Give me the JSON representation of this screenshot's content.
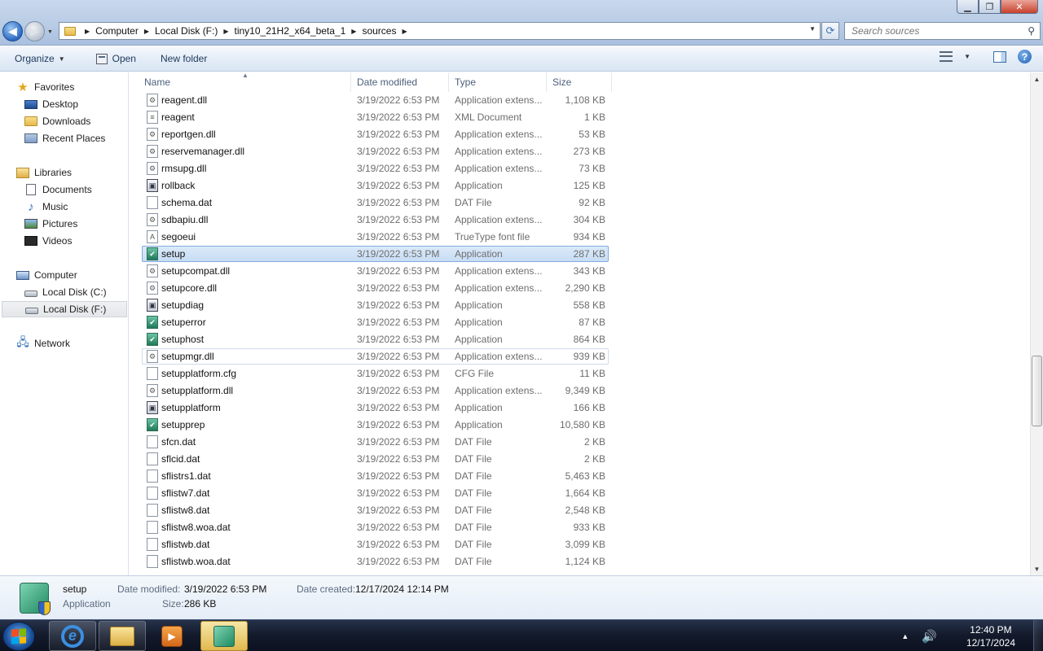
{
  "address": {
    "crumbs": [
      "Computer",
      "Local Disk (F:)",
      "tiny10_21H2_x64_beta_1",
      "sources"
    ]
  },
  "search": {
    "placeholder": "Search sources"
  },
  "toolbar": {
    "organize": "Organize",
    "open": "Open",
    "new_folder": "New folder"
  },
  "nav": {
    "favorites": "Favorites",
    "desktop": "Desktop",
    "downloads": "Downloads",
    "recent_places": "Recent Places",
    "libraries": "Libraries",
    "documents": "Documents",
    "music": "Music",
    "pictures": "Pictures",
    "videos": "Videos",
    "computer": "Computer",
    "local_disk_c": "Local Disk (C:)",
    "local_disk_f": "Local Disk (F:)",
    "network": "Network"
  },
  "columns": {
    "name": "Name",
    "date_modified": "Date modified",
    "type": "Type",
    "size": "Size"
  },
  "files": [
    {
      "name": "reagent.dll",
      "date": "3/19/2022 6:53 PM",
      "type": "Application extens...",
      "size": "1,108 KB",
      "icon": "dll-icon"
    },
    {
      "name": "reagent",
      "date": "3/19/2022 6:53 PM",
      "type": "XML Document",
      "size": "1 KB",
      "icon": "xml-icon"
    },
    {
      "name": "reportgen.dll",
      "date": "3/19/2022 6:53 PM",
      "type": "Application extens...",
      "size": "53 KB",
      "icon": "dll-icon"
    },
    {
      "name": "reservemanager.dll",
      "date": "3/19/2022 6:53 PM",
      "type": "Application extens...",
      "size": "273 KB",
      "icon": "dll-icon"
    },
    {
      "name": "rmsupg.dll",
      "date": "3/19/2022 6:53 PM",
      "type": "Application extens...",
      "size": "73 KB",
      "icon": "dll-icon"
    },
    {
      "name": "rollback",
      "date": "3/19/2022 6:53 PM",
      "type": "Application",
      "size": "125 KB",
      "icon": "app-icon"
    },
    {
      "name": "schema.dat",
      "date": "3/19/2022 6:53 PM",
      "type": "DAT File",
      "size": "92 KB",
      "icon": "file-icon"
    },
    {
      "name": "sdbapiu.dll",
      "date": "3/19/2022 6:53 PM",
      "type": "Application extens...",
      "size": "304 KB",
      "icon": "dll-icon"
    },
    {
      "name": "segoeui",
      "date": "3/19/2022 6:53 PM",
      "type": "TrueType font file",
      "size": "934 KB",
      "icon": "font-icon"
    },
    {
      "name": "setup",
      "date": "3/19/2022 6:53 PM",
      "type": "Application",
      "size": "287 KB",
      "icon": "setup-app-icon"
    },
    {
      "name": "setupcompat.dll",
      "date": "3/19/2022 6:53 PM",
      "type": "Application extens...",
      "size": "343 KB",
      "icon": "dll-icon"
    },
    {
      "name": "setupcore.dll",
      "date": "3/19/2022 6:53 PM",
      "type": "Application extens...",
      "size": "2,290 KB",
      "icon": "dll-icon"
    },
    {
      "name": "setupdiag",
      "date": "3/19/2022 6:53 PM",
      "type": "Application",
      "size": "558 KB",
      "icon": "app-icon"
    },
    {
      "name": "setuperror",
      "date": "3/19/2022 6:53 PM",
      "type": "Application",
      "size": "87 KB",
      "icon": "setup-app-icon"
    },
    {
      "name": "setuphost",
      "date": "3/19/2022 6:53 PM",
      "type": "Application",
      "size": "864 KB",
      "icon": "setup-app-icon"
    },
    {
      "name": "setupmgr.dll",
      "date": "3/19/2022 6:53 PM",
      "type": "Application extens...",
      "size": "939 KB",
      "icon": "dll-icon"
    },
    {
      "name": "setupplatform.cfg",
      "date": "3/19/2022 6:53 PM",
      "type": "CFG File",
      "size": "11 KB",
      "icon": "file-icon"
    },
    {
      "name": "setupplatform.dll",
      "date": "3/19/2022 6:53 PM",
      "type": "Application extens...",
      "size": "9,349 KB",
      "icon": "dll-icon"
    },
    {
      "name": "setupplatform",
      "date": "3/19/2022 6:53 PM",
      "type": "Application",
      "size": "166 KB",
      "icon": "app-icon"
    },
    {
      "name": "setupprep",
      "date": "3/19/2022 6:53 PM",
      "type": "Application",
      "size": "10,580 KB",
      "icon": "setup-app-icon"
    },
    {
      "name": "sfcn.dat",
      "date": "3/19/2022 6:53 PM",
      "type": "DAT File",
      "size": "2 KB",
      "icon": "file-icon"
    },
    {
      "name": "sflcid.dat",
      "date": "3/19/2022 6:53 PM",
      "type": "DAT File",
      "size": "2 KB",
      "icon": "file-icon"
    },
    {
      "name": "sflistrs1.dat",
      "date": "3/19/2022 6:53 PM",
      "type": "DAT File",
      "size": "5,463 KB",
      "icon": "file-icon"
    },
    {
      "name": "sflistw7.dat",
      "date": "3/19/2022 6:53 PM",
      "type": "DAT File",
      "size": "1,664 KB",
      "icon": "file-icon"
    },
    {
      "name": "sflistw8.dat",
      "date": "3/19/2022 6:53 PM",
      "type": "DAT File",
      "size": "2,548 KB",
      "icon": "file-icon"
    },
    {
      "name": "sflistw8.woa.dat",
      "date": "3/19/2022 6:53 PM",
      "type": "DAT File",
      "size": "933 KB",
      "icon": "file-icon"
    },
    {
      "name": "sflistwb.dat",
      "date": "3/19/2022 6:53 PM",
      "type": "DAT File",
      "size": "3,099 KB",
      "icon": "file-icon"
    },
    {
      "name": "sflistwb.woa.dat",
      "date": "3/19/2022 6:53 PM",
      "type": "DAT File",
      "size": "1,124 KB",
      "icon": "file-icon"
    }
  ],
  "selected_file": "setup",
  "hover_file": "setupmgr.dll",
  "details": {
    "name": "setup",
    "type": "Application",
    "date_modified_label": "Date modified:",
    "date_modified": "3/19/2022 6:53 PM",
    "size_label": "Size:",
    "size": "286 KB",
    "date_created_label": "Date created:",
    "date_created": "12/17/2024 12:14 PM"
  },
  "taskbar": {
    "time": "12:40 PM",
    "date": "12/17/2024",
    "apps": [
      "internet-explorer-icon",
      "windows-explorer-icon",
      "media-player-icon",
      "setup-app-icon"
    ]
  }
}
